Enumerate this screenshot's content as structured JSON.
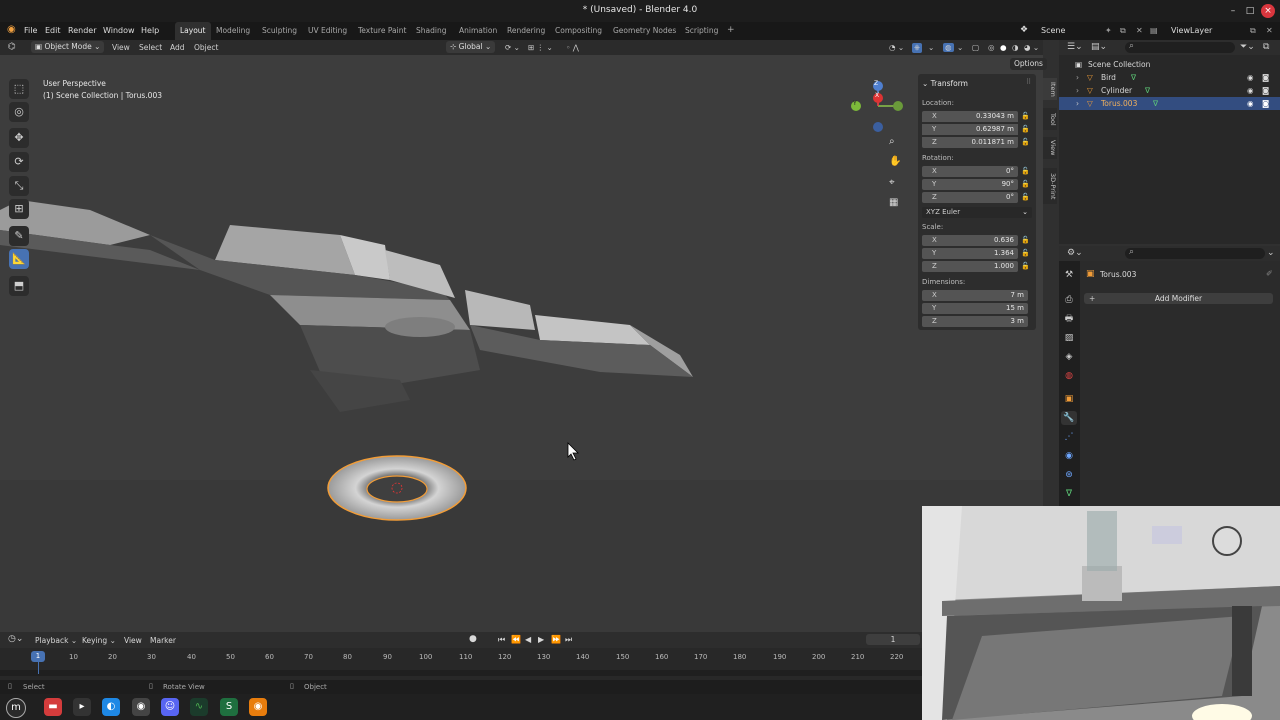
{
  "window": {
    "title": "* (Unsaved) - Blender 4.0",
    "buttons": {
      "minimize": "–",
      "maximize": "□",
      "close": "×"
    }
  },
  "menubar": {
    "menus": [
      "File",
      "Edit",
      "Render",
      "Window",
      "Help"
    ],
    "workspaces": [
      "Layout",
      "Modeling",
      "Sculpting",
      "UV Editing",
      "Texture Paint",
      "Shading",
      "Animation",
      "Rendering",
      "Compositing",
      "Geometry Nodes",
      "Scripting"
    ],
    "active_workspace": "Layout",
    "add_workspace": "+",
    "scene": "Scene",
    "view_layer": "ViewLayer"
  },
  "viewport_header": {
    "mode": "Object Mode",
    "menus": [
      "View",
      "Select",
      "Add",
      "Object"
    ],
    "orientation": "Global",
    "options": "Options"
  },
  "viewport": {
    "perspective_label": "User Perspective",
    "collection_label": "(1) Scene Collection | Torus.003",
    "gizmo_axes": [
      "Z",
      "Y",
      "X"
    ]
  },
  "toolbar": {
    "tools": [
      "select-box",
      "cursor",
      "move",
      "rotate",
      "scale",
      "transform",
      "annotate",
      "measure",
      "add-cube"
    ],
    "active_tool": "measure"
  },
  "npanel": {
    "header": "Transform",
    "location_label": "Location:",
    "location": [
      {
        "axis": "X",
        "value": "0.33043 m"
      },
      {
        "axis": "Y",
        "value": "0.62987 m"
      },
      {
        "axis": "Z",
        "value": "0.011871 m"
      }
    ],
    "rotation_label": "Rotation:",
    "rotation": [
      {
        "axis": "X",
        "value": "0°"
      },
      {
        "axis": "Y",
        "value": "90°"
      },
      {
        "axis": "Z",
        "value": "0°"
      }
    ],
    "rotation_mode": "XYZ Euler",
    "scale_label": "Scale:",
    "scale": [
      {
        "axis": "X",
        "value": "0.636"
      },
      {
        "axis": "Y",
        "value": "1.364"
      },
      {
        "axis": "Z",
        "value": "1.000"
      }
    ],
    "dimensions_label": "Dimensions:",
    "dimensions": [
      {
        "axis": "X",
        "value": "7 m"
      },
      {
        "axis": "Y",
        "value": "15 m"
      },
      {
        "axis": "Z",
        "value": "3 m"
      }
    ],
    "tabs": [
      "Item",
      "Tool",
      "View",
      "3D-Print"
    ]
  },
  "outliner": {
    "root": "Scene Collection",
    "items": [
      {
        "name": "Bird",
        "selected": false
      },
      {
        "name": "Cylinder",
        "selected": false
      },
      {
        "name": "Torus.003",
        "selected": true
      }
    ]
  },
  "properties": {
    "object_name": "Torus.003",
    "add_modifier": "Add Modifier"
  },
  "timeline": {
    "menus": [
      "Playback",
      "Keying",
      "View",
      "Marker"
    ],
    "current_frame": "1",
    "ticks": [
      "10",
      "20",
      "30",
      "40",
      "50",
      "60",
      "70",
      "80",
      "90",
      "100",
      "110",
      "120",
      "130",
      "140",
      "150",
      "160",
      "170",
      "180",
      "190",
      "200",
      "210",
      "220"
    ],
    "playhead": "1"
  },
  "statusbar": {
    "items": [
      "Select",
      "Rotate View",
      "Object"
    ]
  },
  "colors": {
    "accent": "#4772b3",
    "selection_outline": "#f29d38",
    "close_button": "#d9363e"
  }
}
